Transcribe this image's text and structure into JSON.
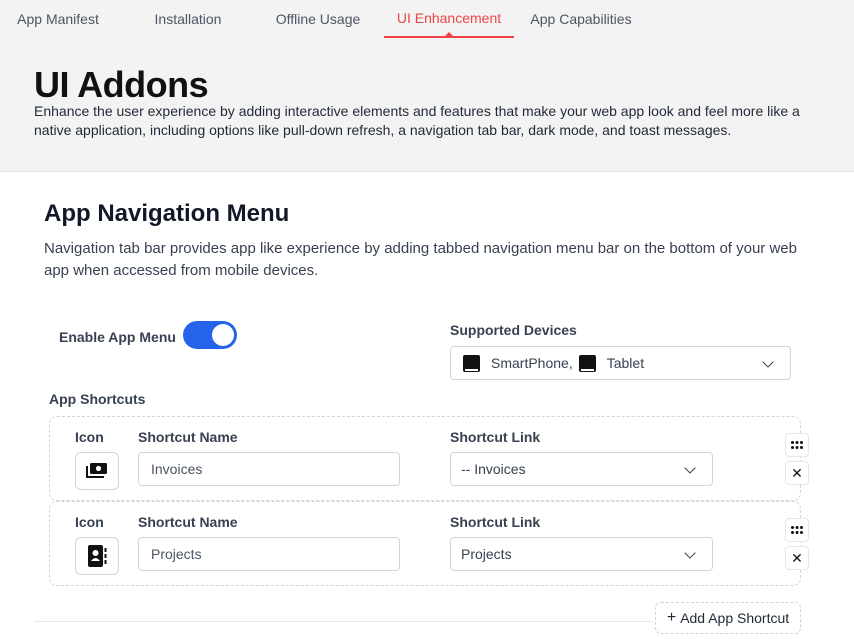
{
  "tabs": [
    {
      "label": "App Manifest",
      "active": false
    },
    {
      "label": "Installation",
      "active": false
    },
    {
      "label": "Offline Usage",
      "active": false
    },
    {
      "label": "UI Enhancement",
      "active": true
    },
    {
      "label": "App Capabilities",
      "active": false
    }
  ],
  "header": {
    "title": "UI Addons",
    "description": "Enhance the user experience by adding interactive elements and features that make your web app look and feel more like a native application, including options like pull-down refresh, a navigation tab bar, dark mode, and toast messages."
  },
  "section": {
    "title": "App Navigation Menu",
    "description": "Navigation tab bar provides app like experience by adding tabbed navigation menu bar on the bottom of your web app when accessed from mobile devices."
  },
  "enable_menu": {
    "label": "Enable App Menu",
    "enabled": true
  },
  "supported_devices": {
    "label": "Supported Devices",
    "values": [
      "SmartPhone,",
      "Tablet"
    ]
  },
  "shortcuts": {
    "label": "App Shortcuts",
    "columns": {
      "icon": "Icon",
      "name": "Shortcut Name",
      "link": "Shortcut Link"
    },
    "rows": [
      {
        "icon": "money-icon",
        "name": "Invoices",
        "link": "-- Invoices"
      },
      {
        "icon": "contact-book-icon",
        "name": "Projects",
        "link": "Projects"
      }
    ],
    "add_label": "Add App Shortcut"
  },
  "glyphs": {
    "remove": "✕",
    "plus": "+"
  },
  "colors": {
    "accent": "#ef4444",
    "toggle": "#2563eb"
  }
}
